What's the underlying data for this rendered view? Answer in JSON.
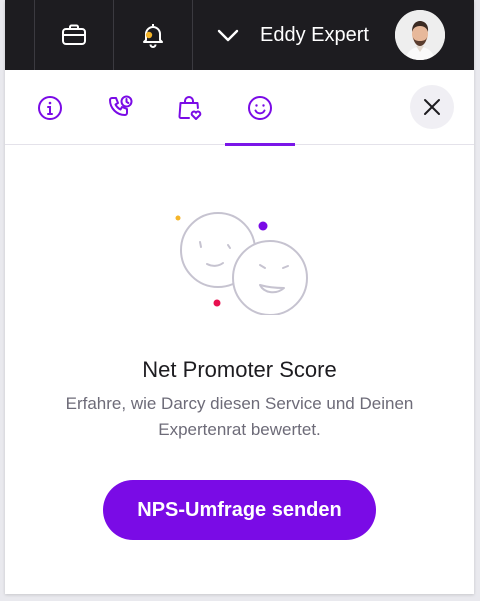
{
  "topbar": {
    "user_name": "Eddy Expert",
    "icons": [
      "briefcase-icon",
      "bell-icon",
      "chevron-down-icon"
    ]
  },
  "tabs": [
    {
      "icon": "info-icon",
      "active": false
    },
    {
      "icon": "phone-clock-icon",
      "active": false
    },
    {
      "icon": "bag-heart-icon",
      "active": false
    },
    {
      "icon": "smiley-icon",
      "active": true
    }
  ],
  "content": {
    "title": "Net Promoter Score",
    "description": "Erfahre, wie Darcy diesen Service und Deinen Expertenrat bewertet.",
    "button_label": "NPS-Umfrage senden"
  },
  "colors": {
    "accent": "#7a0be6",
    "topbar_bg": "#1d1c20",
    "text_muted": "#6d6b78"
  }
}
